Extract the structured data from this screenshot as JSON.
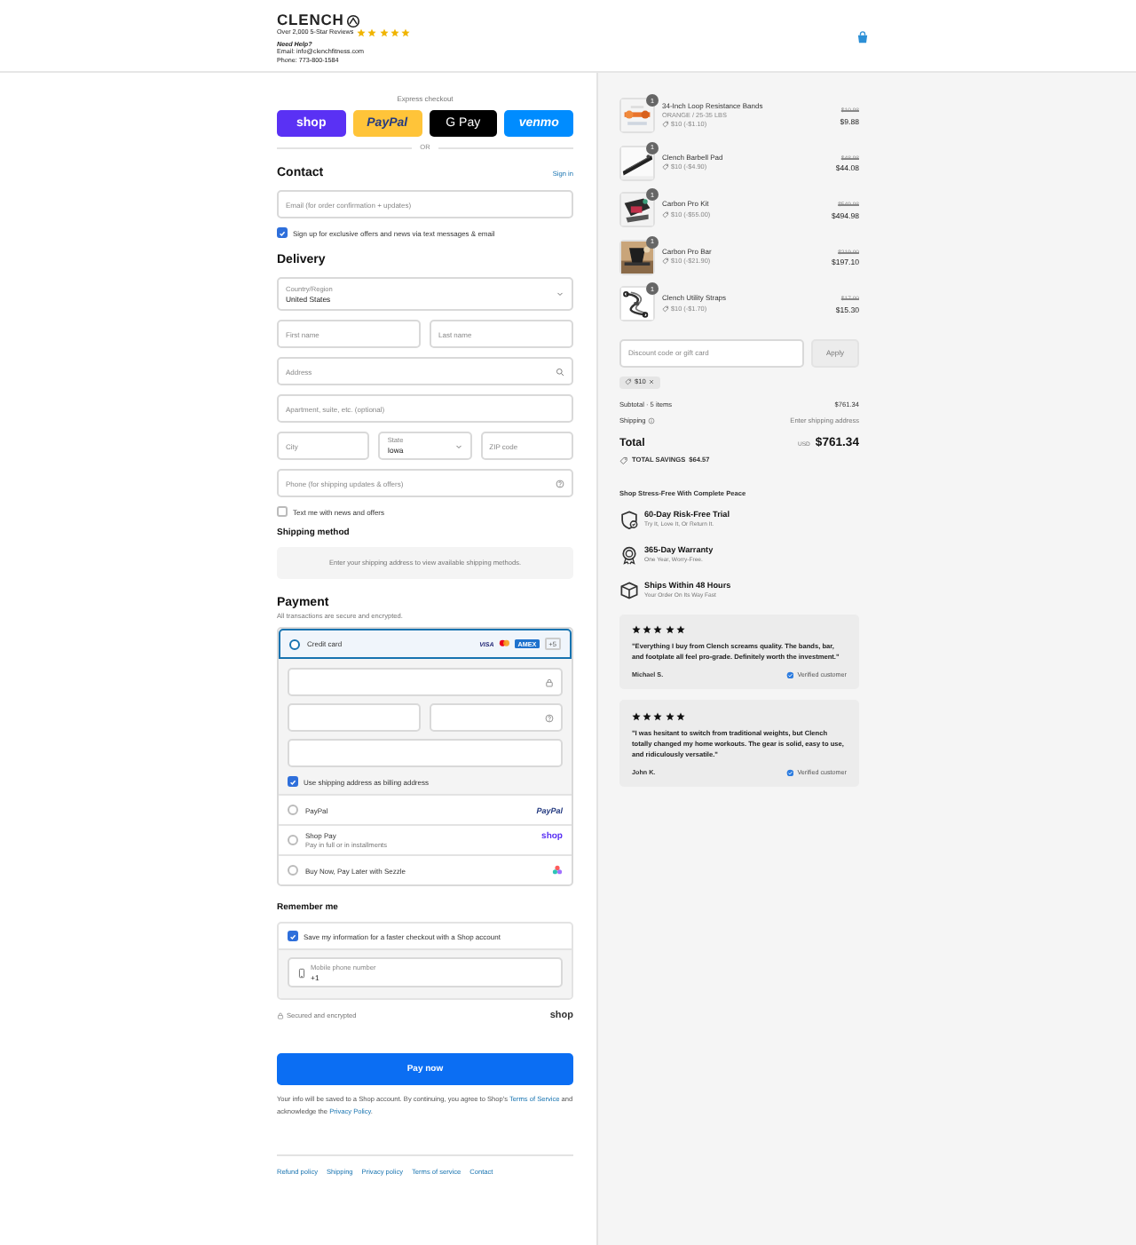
{
  "header": {
    "logo": "CLENCH",
    "reviews_text": "Over 2,000 5-Star Reviews",
    "stars": 5,
    "help_title": "Need Help?",
    "email": "Email: info@clenchfitness.com",
    "phone": "Phone: 773-800-1584"
  },
  "express_checkout": {
    "label": "Express checkout",
    "divider": "OR",
    "buttons": [
      {
        "kind": "shop",
        "label": "shop"
      },
      {
        "kind": "paypal",
        "label": "PayPal"
      },
      {
        "kind": "gpay",
        "label": "G Pay"
      },
      {
        "kind": "venmo",
        "label": "venmo"
      }
    ]
  },
  "contact": {
    "title": "Contact",
    "sign_in": "Sign in",
    "email_placeholder": "Email (for order confirmation + updates)",
    "offers": {
      "label": "Sign up for exclusive offers and news via text messages & email",
      "checked": true
    }
  },
  "delivery": {
    "title": "Delivery",
    "country": {
      "label": "Country/Region",
      "value": "United States"
    },
    "first_name": {
      "placeholder": "First name"
    },
    "last_name": {
      "placeholder": "Last name"
    },
    "address": {
      "placeholder": "Address"
    },
    "apartment": {
      "placeholder": "Apartment, suite, etc. (optional)"
    },
    "city": {
      "placeholder": "City"
    },
    "state": {
      "label": "State",
      "value": "Iowa"
    },
    "zip": {
      "placeholder": "ZIP code"
    },
    "phone": {
      "placeholder": "Phone (for shipping updates & offers)"
    },
    "text_me": {
      "label": "Text me with news and offers",
      "checked": false
    }
  },
  "shipping_method": {
    "title": "Shipping method",
    "message": "Enter your shipping address to view available shipping methods."
  },
  "payment": {
    "title": "Payment",
    "subtitle": "All transactions are secure and encrypted.",
    "methods": [
      {
        "kind": "card",
        "label": "Credit card",
        "selected": true,
        "visa": "VISA",
        "amex": "AMEX",
        "more": "+5",
        "billing": {
          "label": "Use shipping address as billing address",
          "checked": true
        }
      },
      {
        "kind": "paypal",
        "label": "PayPal",
        "selected": false,
        "logo": "PayPal"
      },
      {
        "kind": "shoppay",
        "label": "Shop Pay",
        "selected": false,
        "subtitle": "Pay in full or in installments",
        "logo": "shop"
      },
      {
        "kind": "sezzle",
        "label": "Buy Now, Pay Later with Sezzle",
        "selected": false
      }
    ]
  },
  "remember_me": {
    "title": "Remember me",
    "save": {
      "label": "Save my information for a faster checkout with a Shop account",
      "checked": true
    },
    "mobile": {
      "label": "Mobile phone number",
      "value": "+1"
    },
    "secured": "Secured and encrypted",
    "shop_logo": "shop"
  },
  "pay_button": "Pay now",
  "terms": {
    "before": "Your info will be saved to a Shop account. By continuing, you agree to Shop's ",
    "terms_link": "Terms of Service",
    "middle": " and acknowledge the ",
    "privacy_link": "Privacy Policy",
    "end": "."
  },
  "footer_links": [
    "Refund policy",
    "Shipping",
    "Privacy policy",
    "Terms of service",
    "Contact"
  ],
  "order_summary": {
    "items": [
      {
        "name": "34-Inch Loop Resistance Bands",
        "variant": "ORANGE / 25-35 LBS",
        "discount": "$10 (-$1.10)",
        "old_price": "$10.98",
        "price": "$9.88",
        "quantity": "1",
        "kind": "bands"
      },
      {
        "name": "Clench Barbell Pad",
        "discount": "$10 (-$4.90)",
        "old_price": "$48.98",
        "price": "$44.08",
        "quantity": "1",
        "kind": "pad"
      },
      {
        "name": "Carbon Pro Kit",
        "discount": "$10 (-$55.00)",
        "old_price": "$549.98",
        "price": "$494.98",
        "quantity": "1",
        "kind": "kit"
      },
      {
        "name": "Carbon Pro Bar",
        "discount": "$10 (-$21.90)",
        "old_price": "$219.00",
        "price": "$197.10",
        "quantity": "1",
        "kind": "bar"
      },
      {
        "name": "Clench Utility Straps",
        "discount": "$10 (-$1.70)",
        "old_price": "$17.00",
        "price": "$15.30",
        "quantity": "1",
        "kind": "straps"
      }
    ],
    "discount_placeholder": "Discount code or gift card",
    "apply": "Apply",
    "applied_code": "$10",
    "subtotal_label": "Subtotal · 5 items",
    "subtotal": "$761.34",
    "shipping_label": "Shipping",
    "shipping": "Enter shipping address",
    "total_label": "Total",
    "currency": "USD",
    "total": "$761.34",
    "savings_label": "TOTAL SAVINGS",
    "savings": "$64.57"
  },
  "guarantees": {
    "title": "Shop Stress-Free With Complete Peace",
    "items": [
      {
        "kind": "shield",
        "title": "60-Day Risk-Free Trial",
        "subtitle": "Try It, Love It, Or Return It."
      },
      {
        "kind": "medal",
        "title": "365-Day Warranty",
        "subtitle": "One Year, Worry-Free."
      },
      {
        "kind": "box",
        "title": "Ships Within 48 Hours",
        "subtitle": "Your Order On Its Way Fast"
      }
    ]
  },
  "reviews": [
    {
      "stars": 5,
      "text": "\"Everything I buy from Clench screams quality. The bands, bar, and footplate all feel pro-grade. Definitely worth the investment.\"",
      "author": "Michael S.",
      "verified": "Verified customer"
    },
    {
      "stars": 5,
      "text": "\"I was hesitant to switch from traditional weights, but Clench totally changed my home workouts. The gear is solid, easy to use, and ridiculously versatile.\"",
      "author": "John K.",
      "verified": "Verified customer"
    }
  ]
}
